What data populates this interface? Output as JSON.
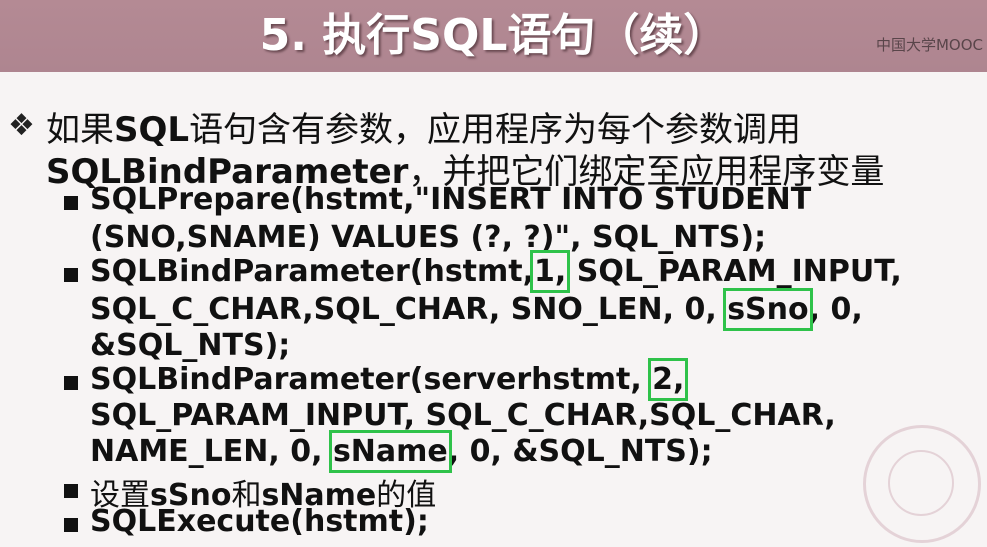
{
  "title": "5. 执行SQL语句（续）",
  "watermark": "中国大学MOOC",
  "intro": {
    "part1_cn": "如果",
    "part1_sql": "SQL",
    "part1_rest": "语句含有参数，应用程序为每个参数调用",
    "part2_bold": "SQLBindParameter",
    "part2_rest": "，并把它们绑定至应用程序变量"
  },
  "items": [
    {
      "lines": [
        "SQLPrepare(hstmt,\"INSERT INTO STUDENT",
        "(SNO,SNAME) VALUES (?, ?)\", SQL_NTS);"
      ]
    },
    {
      "line1_pre": "SQLBindParameter(hstmt,",
      "line1_hl": "1,",
      "line1_post": " SQL_PARAM_INPUT,",
      "line2_pre": "SQL_C_CHAR,SQL_CHAR, SNO_LEN, 0,",
      "line2_hl": "sSno",
      "line2_post": ", 0,",
      "line3": "&SQL_NTS);"
    },
    {
      "line1_pre": "SQLBindParameter(serverhstmt,",
      "line1_hl": "2,",
      "line2": "SQL_PARAM_INPUT, SQL_C_CHAR,SQL_CHAR,",
      "line3_pre": "NAME_LEN, 0,",
      "line3_hl": "sName",
      "line3_post": ", 0, &SQL_NTS);"
    },
    {
      "pre": "设置",
      "v1": "sSno",
      "mid": "和",
      "v2": "sName",
      "post": "的值"
    },
    {
      "line": "SQLExecute(hstmt);"
    }
  ]
}
